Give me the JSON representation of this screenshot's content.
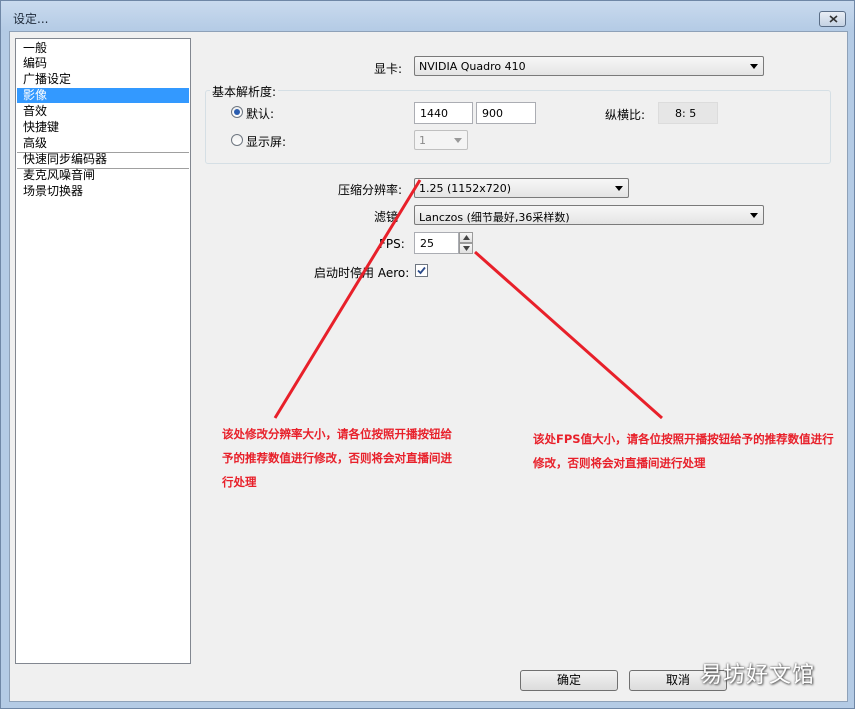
{
  "window": {
    "title": "设定..."
  },
  "nav": {
    "items": [
      "一般",
      "编码",
      "广播设定",
      "影像",
      "音效",
      "快捷键",
      "高级",
      "快速同步编码器",
      "麦克风噪音闸",
      "场景切换器"
    ],
    "selected": "影像"
  },
  "video": {
    "adapter_label": "显卡:",
    "adapter_value": "NVIDIA Quadro 410",
    "base_resolution_title": "基本解析度:",
    "default_label": "默认:",
    "width": "1440",
    "height": "900",
    "aspect_label": "纵横比:",
    "aspect_value": "8: 5",
    "monitor_label": "显示屏:",
    "monitor_value": "1",
    "downscale_label": "压缩分辨率:",
    "downscale_value": "1.25  (1152x720)",
    "filter_label": "滤镜",
    "filter_value": "Lanczos (细节最好,36采样数)",
    "fps_label": "FPS:",
    "fps_value": "25",
    "aero_label": "启动时停用 Aero:",
    "aero_checked": true
  },
  "buttons": {
    "ok": "确定",
    "cancel": "取消"
  },
  "annotations": {
    "resolution": [
      "该处修改分辨率大小，请各位按照开播按钮给",
      "予的推荐数值进行修改，否则将会对直播间进",
      "行处理"
    ],
    "fps": [
      "该处FPS值大小，请各位按照开播按钮给予的推荐数值进行",
      "修改，否则将会对直播间进行处理"
    ],
    "color": "#e8202a"
  },
  "watermark": "易坊好文馆"
}
